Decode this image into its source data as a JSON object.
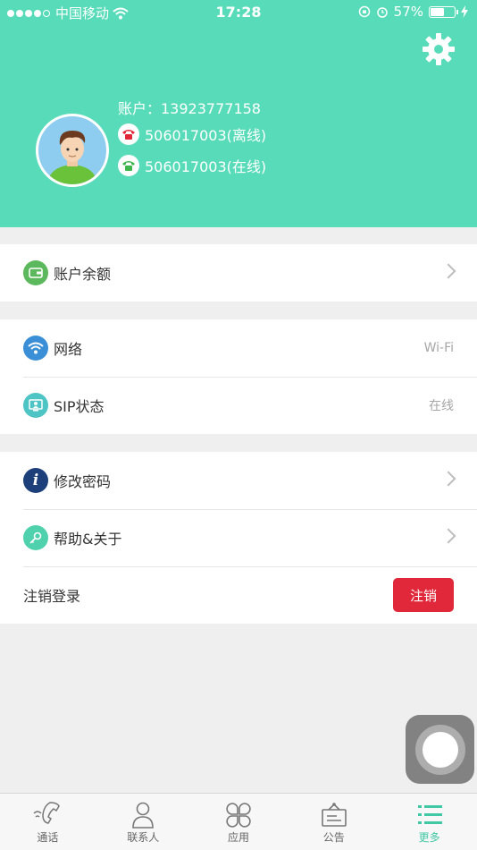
{
  "status_bar": {
    "carrier": "中国移动",
    "time": "17:28",
    "battery": "57%",
    "battery_level": 0.57
  },
  "profile": {
    "account": "账户：13923777158",
    "lines": [
      {
        "number": "506017003(离线)",
        "status_color": "#e0283a"
      },
      {
        "number": "506017003(在线)",
        "status_color": "#3cb54a"
      }
    ]
  },
  "menu": {
    "balance": {
      "label": "账户余额"
    },
    "network": {
      "label": "网络",
      "value": "Wi-Fi"
    },
    "sip": {
      "label": "SIP状态",
      "value": "在线"
    },
    "password": {
      "label": "修改密码"
    },
    "help": {
      "label": "帮助&关于"
    },
    "logout": {
      "label": "注销登录",
      "button": "注销"
    }
  },
  "tabs": [
    {
      "label": "通话",
      "icon": "phone-icon"
    },
    {
      "label": "联系人",
      "icon": "person-icon"
    },
    {
      "label": "应用",
      "icon": "apps-icon"
    },
    {
      "label": "公告",
      "icon": "notice-icon"
    },
    {
      "label": "更多",
      "icon": "more-list-icon",
      "active": true
    }
  ],
  "colors": {
    "header": "#58dbb8",
    "active_tab": "#41c8a4",
    "logout_button": "#e0283a"
  }
}
